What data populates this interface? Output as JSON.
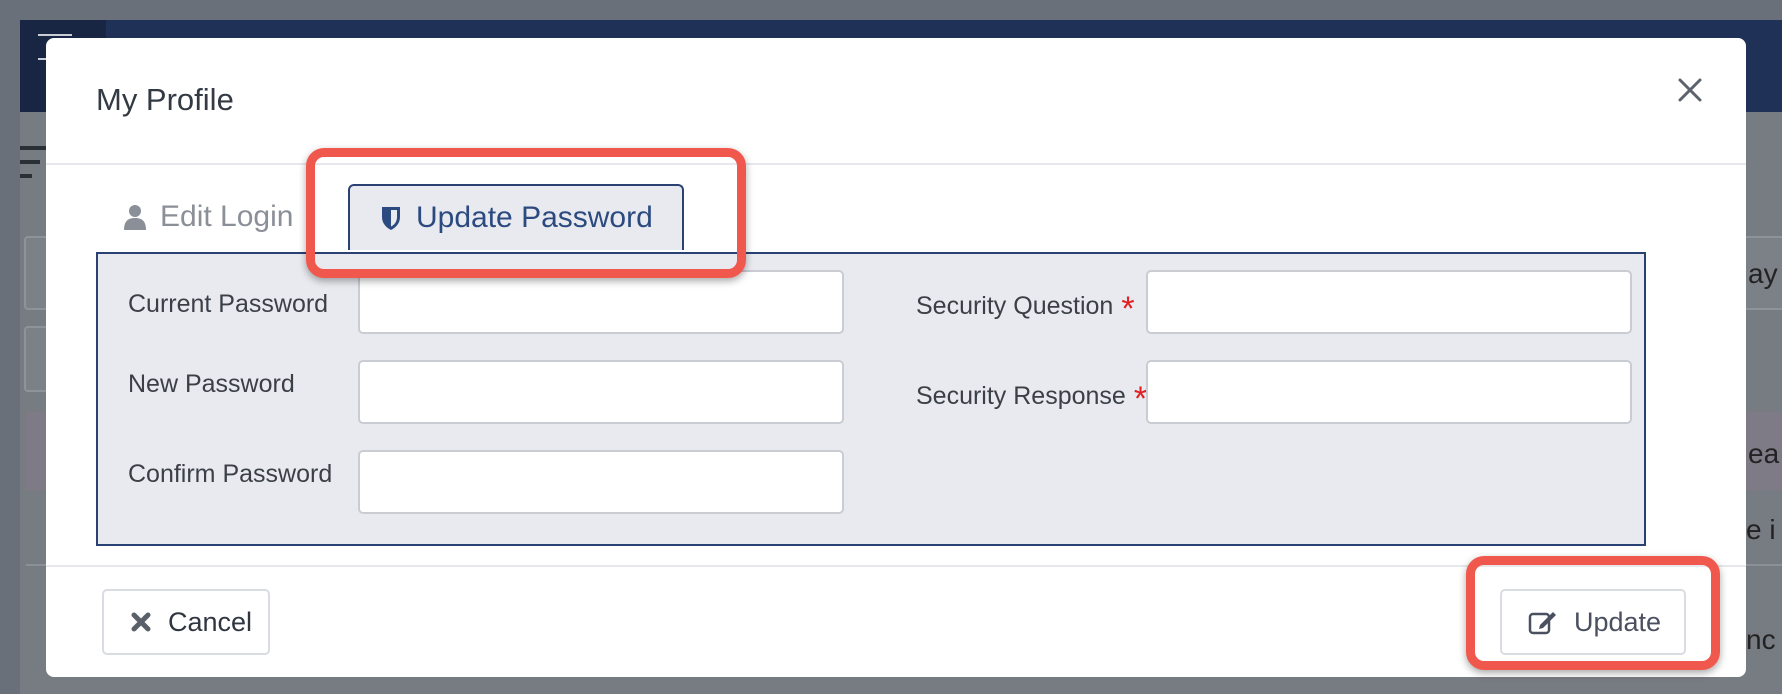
{
  "modal": {
    "title": "My Profile",
    "close_label": "close"
  },
  "tabs": [
    {
      "label": "Edit Login",
      "icon": "user-icon",
      "active": false
    },
    {
      "label": "Update Password",
      "icon": "shield-icon",
      "active": true
    }
  ],
  "form": {
    "left_fields": [
      {
        "label": "Current Password",
        "value": ""
      },
      {
        "label": "New Password",
        "value": ""
      },
      {
        "label": "Confirm Password",
        "value": ""
      }
    ],
    "right_fields": [
      {
        "label": "Security Question",
        "required": true,
        "value": ""
      },
      {
        "label": "Security Response",
        "required": true,
        "value": ""
      }
    ],
    "required_marker": "*"
  },
  "footer": {
    "cancel_label": "Cancel",
    "update_label": "Update"
  },
  "colors": {
    "accent_navy": "#2a4173",
    "highlight": "#f0584e",
    "required": "#e02020",
    "overlay": "#6a7079"
  },
  "background": {
    "partial_texts": [
      "ay",
      "ea",
      "e i",
      "nc"
    ]
  }
}
